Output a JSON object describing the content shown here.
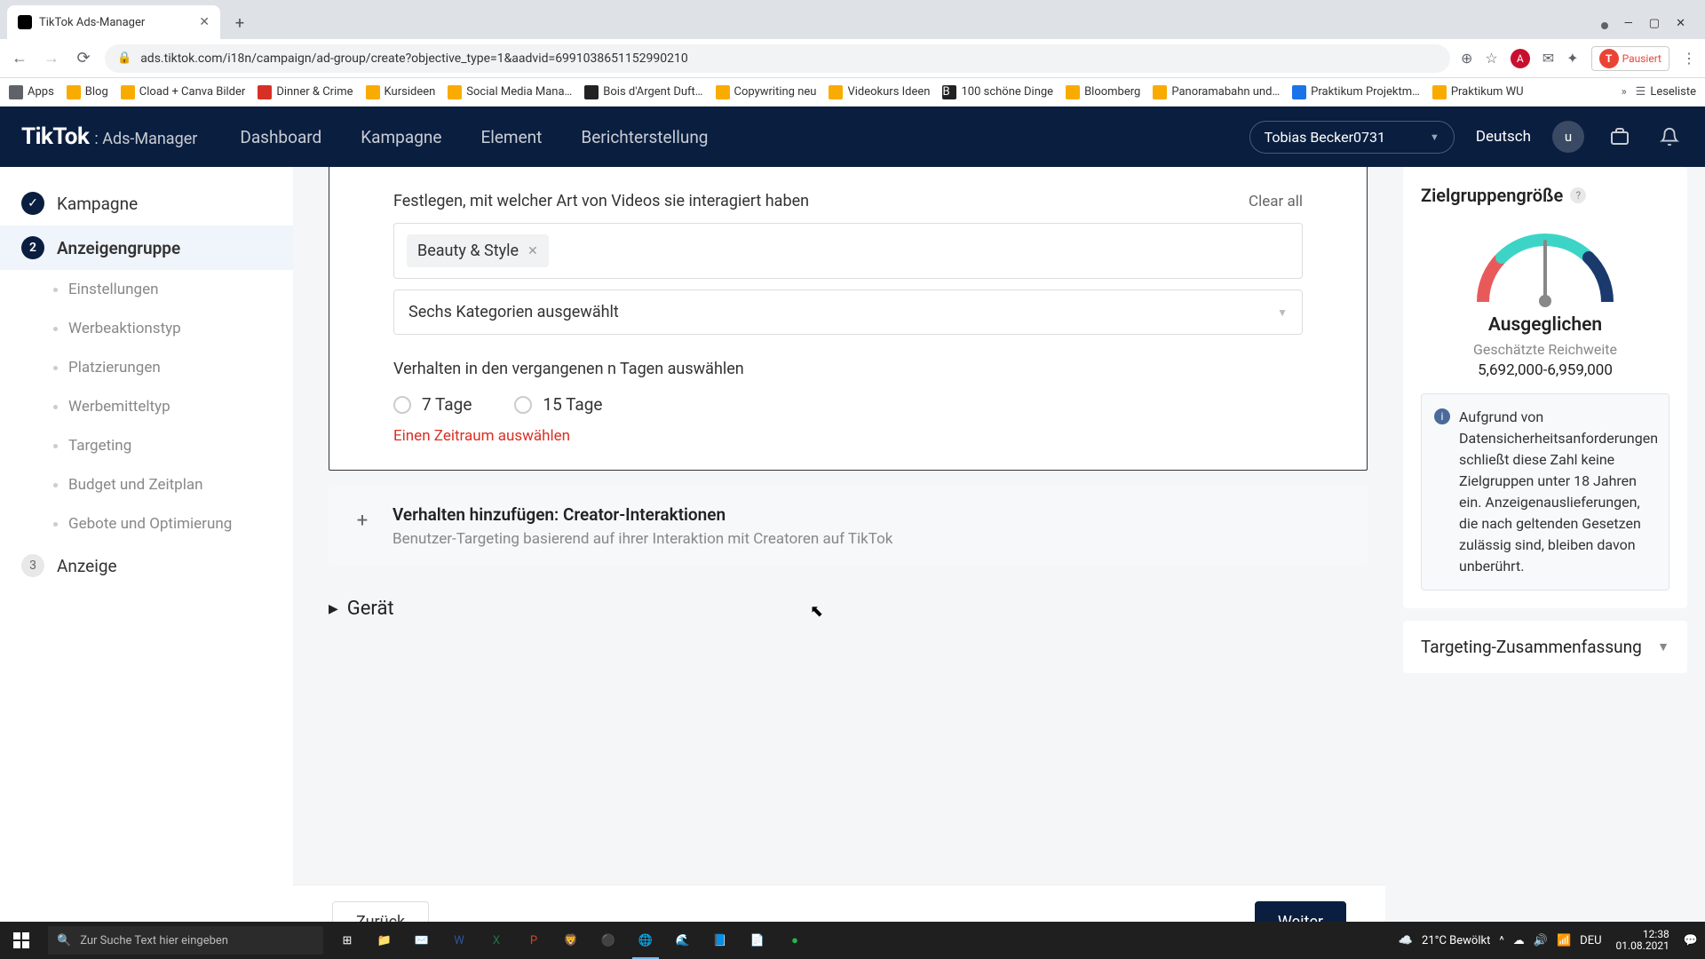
{
  "browser": {
    "tab_title": "TikTok Ads-Manager",
    "url": "ads.tiktok.com/i18n/campaign/ad-group/create?objective_type=1&aadvid=6991038651152990210",
    "paused_label": "Pausiert",
    "window_controls": {
      "min": "—",
      "max": "▢",
      "close": "✕"
    }
  },
  "bookmarks": [
    "Apps",
    "Blog",
    "Cload + Canva Bilder",
    "Dinner & Crime",
    "Kursideen",
    "Social Media Mana…",
    "Bois d'Argent Duft…",
    "Copywriting neu",
    "Videokurs Ideen",
    "100 schöne Dinge",
    "Bloomberg",
    "Panoramabahn und…",
    "Praktikum Projektm…",
    "Praktikum WU"
  ],
  "reading_list": "Leseliste",
  "header": {
    "logo_main": "TikTok",
    "logo_sub": ": Ads-Manager",
    "nav": [
      "Dashboard",
      "Kampagne",
      "Element",
      "Berichterstellung"
    ],
    "account": "Tobias Becker0731",
    "language": "Deutsch",
    "avatar_letter": "u"
  },
  "sidebar": {
    "steps": [
      {
        "num": "✓",
        "label": "Kampagne",
        "state": "done"
      },
      {
        "num": "2",
        "label": "Anzeigengruppe",
        "state": "current"
      },
      {
        "num": "3",
        "label": "Anzeige",
        "state": "pending"
      }
    ],
    "subs": [
      "Einstellungen",
      "Werbeaktionstyp",
      "Platzierungen",
      "Werbemitteltyp",
      "Targeting",
      "Budget und Zeitplan",
      "Gebote und Optimierung"
    ]
  },
  "form": {
    "video_label": "Festlegen, mit welcher Art von Videos sie interagiert haben",
    "clear_all": "Clear all",
    "tag": "Beauty & Style",
    "categories_selected": "Sechs Kategorien ausgewählt",
    "days_label": "Verhalten in den vergangenen n Tagen auswählen",
    "opt_7": "7 Tage",
    "opt_15": "15 Tage",
    "error": "Einen Zeitraum auswählen",
    "add_behavior_title": "Verhalten hinzufügen: Creator-Interaktionen",
    "add_behavior_desc": "Benutzer-Targeting basierend auf ihrer Interaktion mit Creatoren auf TikTok",
    "device_section": "Gerät"
  },
  "footer": {
    "back": "Zurück",
    "next": "Weiter"
  },
  "right": {
    "title": "Zielgruppengröße",
    "balanced": "Ausgeglichen",
    "reach_label": "Geschätzte Reichweite",
    "reach_value": "5,692,000-6,959,000",
    "info": "Aufgrund von Datensicherheitsanforderungen schließt diese Zahl keine Zielgruppen unter 18 Jahren ein. Anzeigenauslieferungen, die nach geltenden Gesetzen zulässig sind, bleiben davon unberührt.",
    "summary": "Targeting-Zusammenfassung"
  },
  "taskbar": {
    "search_placeholder": "Zur Suche Text hier eingeben",
    "weather": "21°C  Bewölkt",
    "lang": "DEU",
    "time": "12:38",
    "date": "01.08.2021"
  }
}
